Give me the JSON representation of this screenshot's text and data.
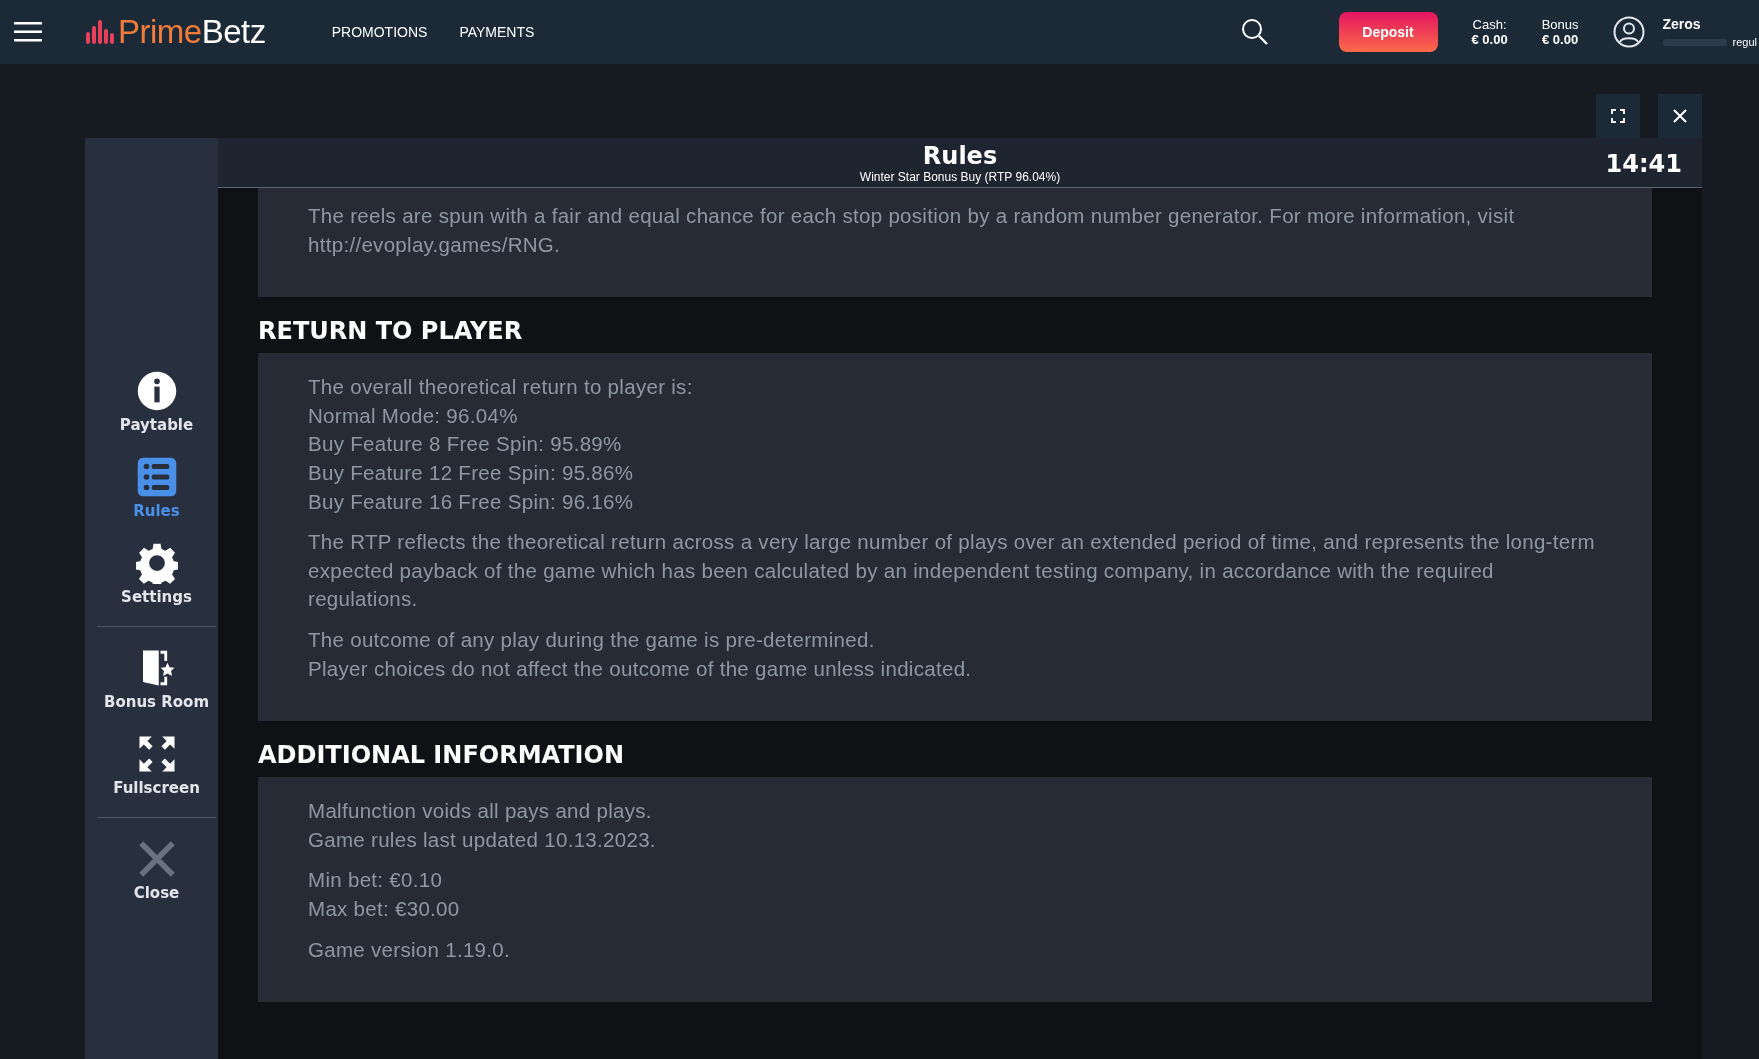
{
  "header": {
    "brand": {
      "first": "Prime",
      "second": "Betz"
    },
    "nav": [
      "PROMOTIONS",
      "PAYMENTS"
    ],
    "deposit": "Deposit",
    "balances": [
      {
        "label": "Cash:",
        "value": "€ 0.00"
      },
      {
        "label": "Bonus",
        "value": "€ 0.00"
      }
    ],
    "user": {
      "name": "Zeros",
      "tier": "regul"
    }
  },
  "dialog": {
    "title": "Rules",
    "subtitle": "Winter Star Bonus Buy (RTP 96.04%)",
    "time": "14:41",
    "sidebar": [
      [
        {
          "kind": "info",
          "label": "Paytable",
          "selected": false
        },
        {
          "kind": "list",
          "label": "Rules",
          "selected": true
        },
        {
          "kind": "gear",
          "label": "Settings",
          "selected": false
        }
      ],
      [
        {
          "kind": "door",
          "label": "Bonus Room",
          "selected": false
        },
        {
          "kind": "expand",
          "label": "Fullscreen",
          "selected": false
        }
      ],
      [
        {
          "kind": "close",
          "label": "Close",
          "selected": false
        }
      ]
    ],
    "sections": [
      {
        "blocks": [
          [
            "The reels are spun with a fair and equal chance for each stop position by a random number generator. For more information, visit http://evoplay.games/RNG."
          ]
        ]
      },
      {
        "heading": "RETURN TO PLAYER",
        "blocks": [
          [
            "The overall theoretical return to player is:",
            "Normal Mode: 96.04%",
            "Buy Feature 8 Free Spin: 95.89%",
            "Buy Feature 12 Free Spin: 95.86%",
            "Buy Feature 16 Free Spin: 96.16%"
          ],
          [
            "The RTP reflects the theoretical return across a very large number of plays over an extended period of time, and represents the long-term expected payback of the game which has been calculated by an independent testing company, in accordance with the required regulations."
          ],
          [
            "The outcome of any play during the game is pre-determined.",
            "Player choices do not affect the outcome of the game unless indicated."
          ]
        ]
      },
      {
        "heading": "ADDITIONAL INFORMATION",
        "blocks": [
          [
            "Malfunction voids all pays and plays.",
            "Game rules last updated 10.13.2023."
          ],
          [
            "Min bet: €0.10",
            "Max bet: €30.00"
          ],
          [
            "Game version 1.19.0."
          ]
        ]
      }
    ]
  }
}
